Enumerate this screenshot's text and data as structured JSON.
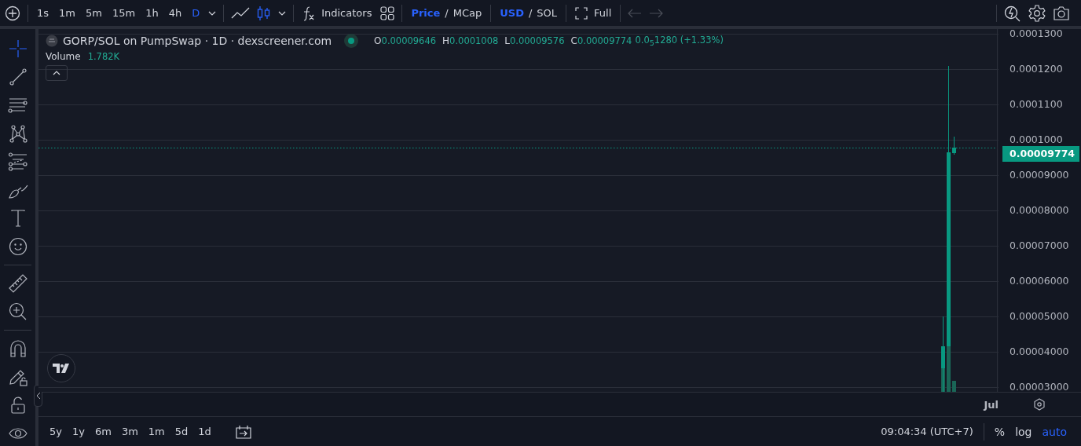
{
  "toolbar": {
    "intervals": [
      {
        "label": "1s",
        "selected": false
      },
      {
        "label": "1m",
        "selected": false
      },
      {
        "label": "5m",
        "selected": false
      },
      {
        "label": "15m",
        "selected": false
      },
      {
        "label": "1h",
        "selected": false
      },
      {
        "label": "4h",
        "selected": false
      },
      {
        "label": "D",
        "selected": true
      }
    ],
    "indicators": "Indicators",
    "price_mode": [
      {
        "label": "Price",
        "selected": true
      },
      {
        "label": "MCap",
        "selected": false
      }
    ],
    "price_separator": "/",
    "currency": [
      {
        "label": "USD",
        "selected": true
      },
      {
        "label": "SOL",
        "selected": false
      }
    ],
    "currency_separator": "/",
    "full": "Full"
  },
  "tools": [
    {
      "kind": "crosshair",
      "selected": true
    },
    {
      "kind": "trendline",
      "selected": false
    },
    {
      "kind": "lines",
      "selected": false
    },
    {
      "kind": "pattern",
      "selected": false
    },
    {
      "kind": "fib",
      "selected": false
    },
    {
      "kind": "brush",
      "selected": false
    },
    {
      "kind": "text",
      "selected": false
    },
    {
      "kind": "emoji",
      "selected": false
    },
    {
      "kind": "divider"
    },
    {
      "kind": "ruler",
      "selected": false
    },
    {
      "kind": "zoom",
      "selected": false
    },
    {
      "kind": "divider"
    },
    {
      "kind": "magnet",
      "selected": false
    },
    {
      "kind": "pencil-lock",
      "selected": false
    },
    {
      "kind": "lock",
      "selected": false
    },
    {
      "kind": "eye"
    }
  ],
  "legend": {
    "title": "GORP/SOL on PumpSwap · 1D · dexscreener.com",
    "ohlc": [
      {
        "key": "O",
        "value": "0.00009646"
      },
      {
        "key": "H",
        "value": "0.0001008"
      },
      {
        "key": "L",
        "value": "0.00009576"
      },
      {
        "key": "C",
        "value": "0.00009774"
      }
    ],
    "change": "0.0$_{5}$1280 (+1.33%)",
    "volume_label": "Volume",
    "volume_value": "1.782K"
  },
  "price_axis": {
    "labels": [
      "0.0001300",
      "0.0001200",
      "0.0001100",
      "0.0001000",
      "0.00009000",
      "0.00008000",
      "0.00007000",
      "0.00006000",
      "0.00005000",
      "0.00004000",
      "0.00003000"
    ],
    "last_price": "0.00009774"
  },
  "time_axis": {
    "labels": [
      "Jul"
    ]
  },
  "bottom_bar": {
    "ranges": [
      "5y",
      "1y",
      "6m",
      "3m",
      "1m",
      "5d",
      "1d"
    ],
    "time": "09:04:34 (UTC+7)",
    "percent": "%",
    "log": "log",
    "auto": "auto",
    "auto_on": true
  }
}
